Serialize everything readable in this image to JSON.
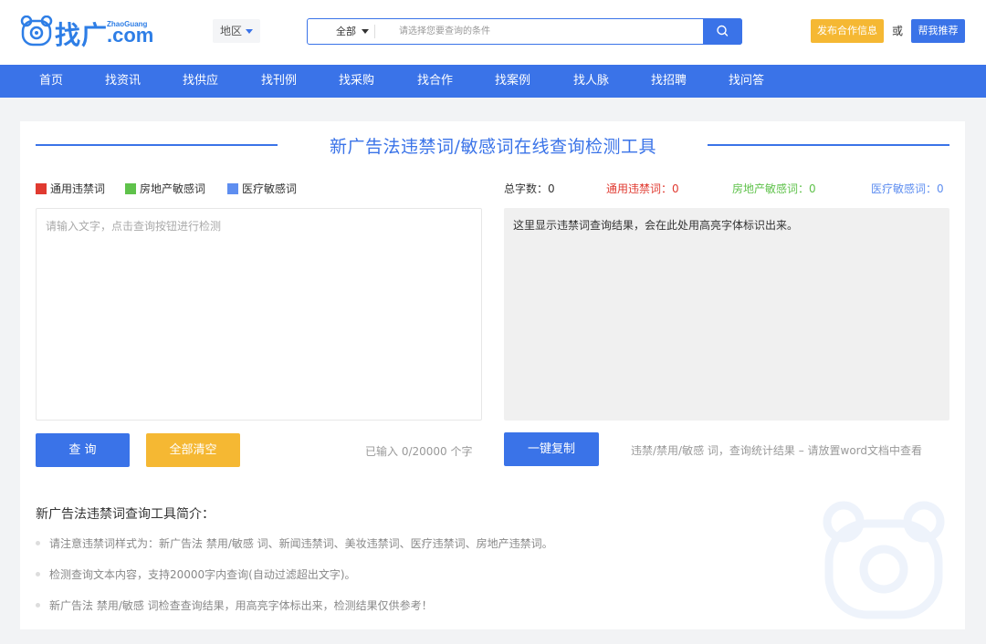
{
  "header": {
    "logo_cn": "找广",
    "logo_en": "ZhaoGuang",
    "logo_com": ".com",
    "region_label": "地区",
    "search_scope": "全部",
    "search_placeholder": "请选择您要查询的条件",
    "publish_label": "发布合作信息",
    "or_label": "或",
    "recommend_label": "帮我推荐"
  },
  "nav": {
    "items": [
      "首页",
      "找资讯",
      "找供应",
      "找刊例",
      "找采购",
      "找合作",
      "找案例",
      "找人脉",
      "找招聘",
      "找问答"
    ]
  },
  "tool": {
    "title": "新广告法违禁词/敏感词在线查询检测工具",
    "legend": [
      "通用违禁词",
      "房地产敏感词",
      "医疗敏感词"
    ],
    "stats": {
      "total_label": "总字数：",
      "total_value": "0",
      "general_label": "通用违禁词：",
      "general_value": "0",
      "estate_label": "房地产敏感词：",
      "estate_value": "0",
      "medical_label": "医疗敏感词：",
      "medical_value": "0"
    },
    "input_placeholder": "请输入文字，点击查询按钮进行检测",
    "input_value": "",
    "result_text": "这里显示违禁词查询结果，会在此处用高亮字体标识出来。",
    "query_label": "查 询",
    "clear_label": "全部清空",
    "counter_text": "已输入 0/20000 个字",
    "copy_label": "一键复制",
    "hint_text": "违禁/禁用/敏感 词，查询统计结果 – 请放置word文档中查看"
  },
  "intro": {
    "title": "新广告法违禁词查询工具简介：",
    "items": [
      "请注意违禁词样式为：新广告法 禁用/敏感 词、新闻违禁词、美妆违禁词、医疗违禁词、房地产违禁词。",
      "检测查询文本内容，支持20000字内查询(自动过滤超出文字)。",
      "新广告法 禁用/敏感 词检查查询结果，用高亮字体标出来，检测结果仅供参考！"
    ]
  },
  "colors": {
    "accent": "#3a73e8",
    "general": "#e03a30",
    "estate": "#5fc24b",
    "medical": "#5e8ef0",
    "warning": "#f5b833"
  }
}
